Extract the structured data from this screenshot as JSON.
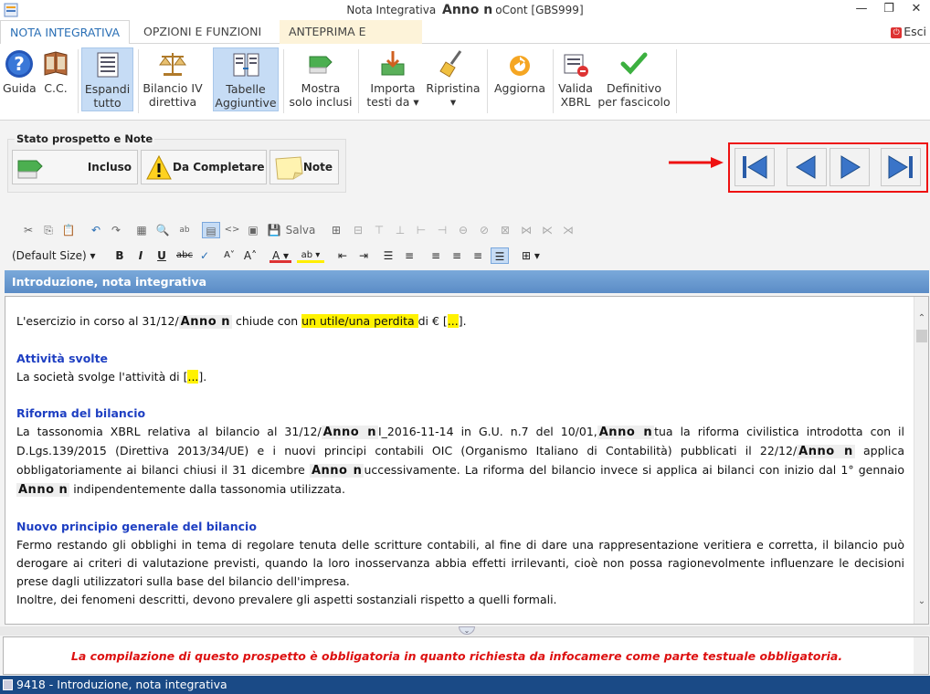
{
  "window": {
    "title_prefix": "Nota Integrativa ",
    "title_anno": "Anno n",
    "title_suffix": "oCont [GBS999]",
    "minimize": "—",
    "restore": "❐",
    "close": "✕"
  },
  "ribbon_tabs": [
    "NOTA INTEGRATIVA",
    "OPZIONI E FUNZIONI",
    "ANTEPRIMA E STAMPA"
  ],
  "esci": {
    "label": "Esci",
    "icon": "power-icon"
  },
  "ribbon": {
    "guida": "Guida",
    "cc": "C.C.",
    "espandi": [
      "Espandi",
      "tutto"
    ],
    "bilancio": [
      "Bilancio IV",
      "direttiva"
    ],
    "tabelle": [
      "Tabelle",
      "Aggiuntive"
    ],
    "mostra": [
      "Mostra",
      "solo inclusi"
    ],
    "importa": [
      "Importa",
      "testi da ▾"
    ],
    "ripristina": [
      "Ripristina",
      "▾"
    ],
    "aggiorna": "Aggiorna",
    "valida": [
      "Valida",
      "XBRL"
    ],
    "definitivo": [
      "Definitivo",
      "per fascicolo"
    ]
  },
  "stato": {
    "title": "Stato prospetto e Note",
    "incluso": "Incluso",
    "da_completare": "Da Completare",
    "note": "Note"
  },
  "toolbar": {
    "salva": "Salva",
    "font_size": "(Default Size)"
  },
  "section_title": "Introduzione, nota integrativa",
  "doc": {
    "p1_a": "L'esercizio in corso al 31/12/",
    "anno": "Anno n",
    "p1_b": " chiude con ",
    "p1_hl": "un utile/una perdita ",
    "p1_c": "di € [",
    "ellipsis": "...",
    "p1_d": "].",
    "h_attivita": "Attività svolte",
    "p2_a": "La società svolge l'attività di [",
    "p2_b": "].",
    "h_riforma": "Riforma del bilancio",
    "p3_a": "La tassonomia XBRL relativa al bilancio al 31/12/",
    "p3_b": "I_2016-11-14 in G.U. n.7 del 10/01,",
    "p3_c": "tua la riforma civilistica introdotta con il D.Lgs.139/2015 (Direttiva 2013/34/UE) e i nuovi principi contabili OIC (Organismo Italiano di Contabilità) pubblicati il 22/12/",
    "p3_d": " applica obbligatoriamente ai bilanci chiusi il 31 dicembre ",
    "p3_e": "uccessivamente. La riforma del bilancio invece si applica ai bilanci con inizio dal 1° gennaio ",
    "p3_f": "indipendentemente dalla tassonomia utilizzata.",
    "h_principio": "Nuovo principio generale del bilancio",
    "p4": "Fermo restando gli obblighi in tema di regolare tenuta delle scritture contabili, al fine di dare una rappresentazione veritiera e corretta, il bilancio può derogare ai criteri di valutazione previsti, quando la loro inosservanza abbia effetti irrilevanti, cioè non possa ragionevolmente influenzare le decisioni prese dagli utilizzatori sulla base del bilancio dell'impresa.",
    "p5": "Inoltre, dei fenomeni descritti, devono prevalere gli aspetti sostanziali rispetto a quelli formali."
  },
  "note_message": "La compilazione di questo prospetto è obbligatoria in quanto richiesta da infocamere come parte testuale obbligatoria.",
  "status_bar": "9418 - Introduzione, nota integrativa",
  "colors": {
    "accent": "#2a6fb5",
    "heading": "#1e3fc2",
    "highlight": "#fff200",
    "status_bg": "#1a4a86",
    "alert": "#dd1111"
  }
}
